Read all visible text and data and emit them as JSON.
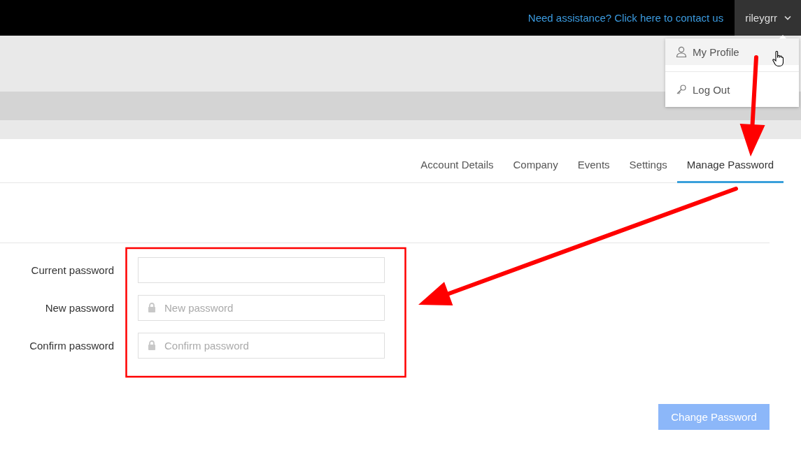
{
  "top_bar": {
    "help_link": "Need assistance? Click here to contact us",
    "user_menu": {
      "username": "rileygrr",
      "expanded": true
    }
  },
  "user_dropdown": [
    {
      "label": "My Profile",
      "kind": "profile",
      "highlighted": true
    },
    {
      "label": "Log Out",
      "kind": "logout",
      "highlighted": false
    }
  ],
  "tabs": [
    {
      "label": "Account Details",
      "selected": false
    },
    {
      "label": "Company",
      "selected": false
    },
    {
      "label": "Events",
      "selected": false
    },
    {
      "label": "Settings",
      "selected": false
    },
    {
      "label": "Manage Password",
      "selected": true
    }
  ],
  "form": {
    "fields": [
      {
        "label": "Current password",
        "kind": "plain"
      },
      {
        "label": "New password",
        "kind": "lock",
        "placeholder": "New password"
      },
      {
        "label": "Confirm password",
        "kind": "lock",
        "placeholder": "Confirm password"
      }
    ],
    "submit": {
      "label": "Change Password",
      "disabled": true
    }
  },
  "annotations": [
    {
      "kind": "box"
    },
    {
      "kind": "arrow"
    },
    {
      "kind": "arrow"
    }
  ]
}
